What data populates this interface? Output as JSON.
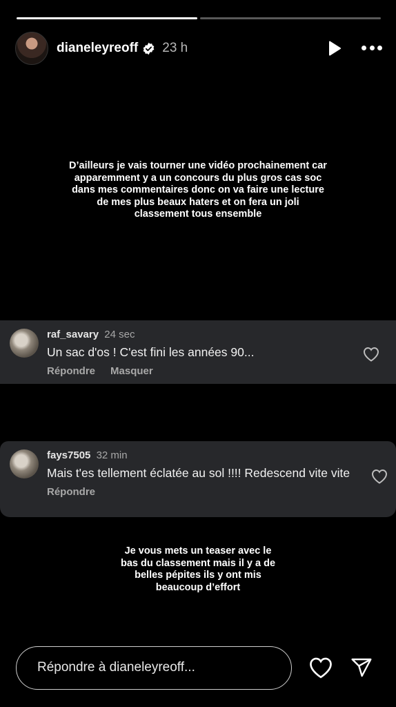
{
  "story": {
    "progress": [
      1.0,
      0.0
    ],
    "username": "dianeleyreoff",
    "verified": true,
    "time": "23 h",
    "caption_top": "D’ailleurs je vais tourner une vidéo prochainement car apparemment y a un concours du plus gros cas soc dans mes commentaires donc on va faire une lecture de mes plus beaux haters et on fera un joli classement tous ensemble",
    "caption_bottom": "Je vous mets un teaser avec le bas du classement mais il y a de belles pépites ils y ont mis beaucoup d’effort"
  },
  "comments": [
    {
      "user": "raf_savary",
      "time": "24 sec",
      "text": "Un sac d'os ! C'est fini les années 90...",
      "actions": [
        "Répondre",
        "Masquer"
      ]
    },
    {
      "user": "fays7505",
      "time": "32 min",
      "text": "Mais t'es tellement éclatée au sol !!!! Redescend vite vite",
      "actions": [
        "Répondre"
      ]
    }
  ],
  "footer": {
    "reply_placeholder": "Répondre à dianeleyreoff..."
  },
  "colors": {
    "background": "#000000",
    "comment_bg": "#27282b",
    "muted_text": "#a8a8a8"
  }
}
